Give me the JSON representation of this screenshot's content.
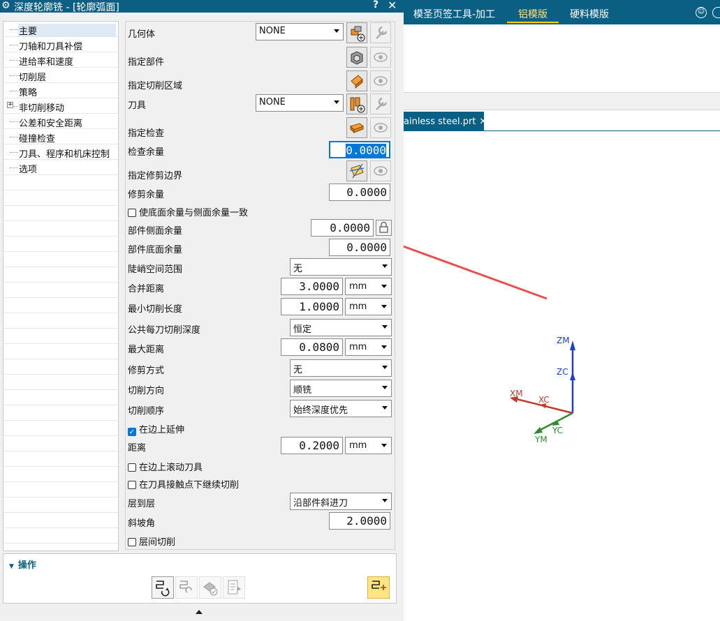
{
  "dialog": {
    "title": "深度轮廓铣 - [轮廓弧面]",
    "help": "?",
    "close": "✕"
  },
  "ribbon": {
    "tabs": [
      "模圣页签工具-加工",
      "铝模版",
      "硬料模版"
    ],
    "active_tab": "铝模版"
  },
  "file_tab": {
    "name": "ainless steel.prt",
    "close": "✕"
  },
  "nav": {
    "items": [
      {
        "label": "主要",
        "selected": true
      },
      {
        "label": "刀轴和刀具补偿"
      },
      {
        "label": "进给率和速度"
      },
      {
        "label": "切削层"
      },
      {
        "label": "策略"
      },
      {
        "label": "非切削移动",
        "expandable": true
      },
      {
        "label": "公差和安全距离"
      },
      {
        "label": "碰撞检查"
      },
      {
        "label": "刀具、程序和机床控制"
      },
      {
        "label": "选项"
      }
    ],
    "plus": "+"
  },
  "main": {
    "geometry": {
      "label": "几何体",
      "value": "NONE"
    },
    "part": {
      "label": "指定部件"
    },
    "cut_area": {
      "label": "指定切削区域"
    },
    "tool": {
      "label": "刀具",
      "value": "NONE"
    },
    "check": {
      "label": "指定检查"
    },
    "check_stock": {
      "label": "检查余量",
      "value": "0.0000"
    },
    "trim_boundary": {
      "label": "指定修剪边界"
    },
    "trim_stock": {
      "label": "修剪余量",
      "value": "0.0000"
    },
    "same_stock_check": {
      "label": "使底面余量与侧面余量一致",
      "checked": false
    },
    "part_side_stock": {
      "label": "部件侧面余量",
      "value": "0.0000"
    },
    "part_floor_stock": {
      "label": "部件底面余量",
      "value": "0.0000"
    },
    "steep_range": {
      "label": "陡峭空间范围",
      "value": "无"
    },
    "merge_distance": {
      "label": "合并距离",
      "value": "3.0000",
      "unit": "mm"
    },
    "min_cut_length": {
      "label": "最小切削长度",
      "value": "1.0000",
      "unit": "mm"
    },
    "common_depth": {
      "label": "公共每刀切削深度",
      "value": "恒定"
    },
    "max_distance": {
      "label": "最大距离",
      "value": "0.0800",
      "unit": "mm"
    },
    "trim_method": {
      "label": "修剪方式",
      "value": "无"
    },
    "cut_direction": {
      "label": "切削方向",
      "value": "顺铣"
    },
    "cut_order": {
      "label": "切削顺序",
      "value": "始终深度优先"
    },
    "extend_at_edges": {
      "label": "在边上延伸",
      "checked": true
    },
    "distance": {
      "label": "距离",
      "value": "0.2000",
      "unit": "mm"
    },
    "roll_tool_over_edges": {
      "label": "在边上滚动刀具",
      "checked": false
    },
    "continue_below_contact": {
      "label": "在刀具接触点下继续切削",
      "checked": false
    },
    "level_to_level": {
      "label": "层到层",
      "value": "沿部件斜进刀"
    },
    "ramp_angle": {
      "label": "斜坡角",
      "value": "2.0000"
    },
    "between_levels": {
      "label": "层间切削",
      "checked": false
    }
  },
  "actions": {
    "header": "操作"
  },
  "triad": {
    "labels": {
      "zm": "ZM",
      "zc": "ZC",
      "xm": "XM",
      "xc": "XC",
      "yc": "YC",
      "ym": "YM"
    },
    "colors": {
      "z": "#1d3fcf",
      "x": "#c0392b",
      "y": "#2e8b2e"
    }
  },
  "annotation": {
    "arrow_color": "#e85050"
  },
  "colors": {
    "accent": "#0b5f83",
    "selection": "#0078d7"
  }
}
